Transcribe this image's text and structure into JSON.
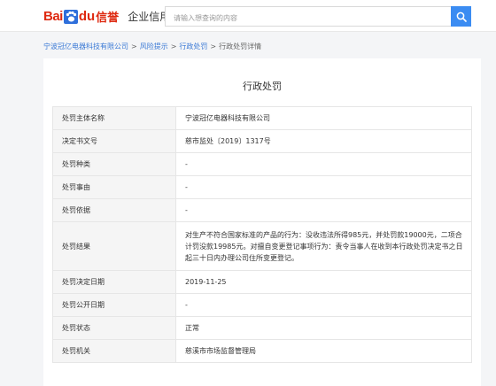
{
  "header": {
    "logo_bai": "Bai",
    "logo_du": "du",
    "logo_xin": "信誉",
    "title": "企业信用",
    "search_placeholder": "请输入想查询的内容"
  },
  "breadcrumb": {
    "items": [
      "宁波冠亿电器科技有限公司",
      "风险提示",
      "行政处罚",
      "行政处罚详情"
    ],
    "separator": ">"
  },
  "card": {
    "title": "行政处罚",
    "rows": [
      {
        "key": "处罚主体名称",
        "value": "宁波冠亿电器科技有限公司"
      },
      {
        "key": "决定书文号",
        "value": "慈市监处〔2019〕1317号"
      },
      {
        "key": "处罚种类",
        "value": "-"
      },
      {
        "key": "处罚事由",
        "value": "-"
      },
      {
        "key": "处罚依据",
        "value": "-"
      },
      {
        "key": "处罚结果",
        "value": "对生产不符合国家标准的产品的行为：没收违法所得985元，并处罚款19000元，二项合计罚没款19985元。对擅自变更登记事项行为：责令当事人在收到本行政处罚决定书之日起三十日内办理公司住所变更登记。"
      },
      {
        "key": "处罚决定日期",
        "value": "2019-11-25"
      },
      {
        "key": "处罚公开日期",
        "value": "-"
      },
      {
        "key": "处罚状态",
        "value": "正常"
      },
      {
        "key": "处罚机关",
        "value": "慈溪市市场监督管理局"
      }
    ]
  },
  "colors": {
    "brand_red": "#de2910",
    "brand_blue": "#2f6fdb",
    "search_button": "#3b8cf2",
    "link": "#3b7ad6"
  }
}
